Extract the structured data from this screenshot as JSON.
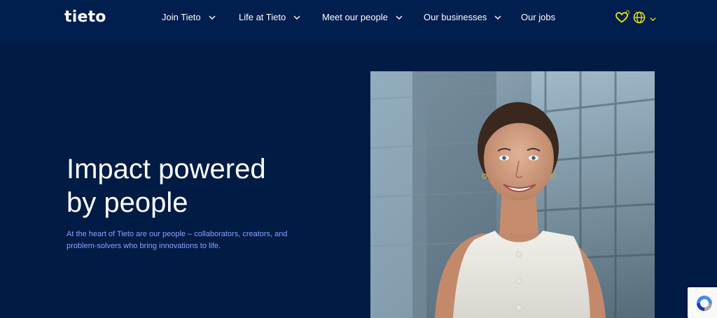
{
  "header": {
    "logo_text": "tieto",
    "nav": [
      {
        "label": "Join Tieto",
        "has_dropdown": true
      },
      {
        "label": "Life at Tieto",
        "has_dropdown": true
      },
      {
        "label": "Meet our people",
        "has_dropdown": true
      },
      {
        "label": "Our businesses",
        "has_dropdown": true
      },
      {
        "label": "Our jobs",
        "has_dropdown": false
      }
    ],
    "favorites_count": "0",
    "favorites_icon": "heart-icon",
    "language_icon": "globe-icon"
  },
  "hero": {
    "title_line1": "Impact powered",
    "title_line2": "by people",
    "description": "At the heart of Tieto are our people – collaborators, creators, and problem-solvers who bring innovations to life.",
    "image_alt": "Smiling woman in a white sleeveless top in front of a glass office building"
  },
  "colors": {
    "background": "#001b44",
    "header_bg": "#001e4e",
    "accent_yellow": "#f3e600",
    "link_blue": "#8aa2ff",
    "text_white": "#ffffff"
  }
}
